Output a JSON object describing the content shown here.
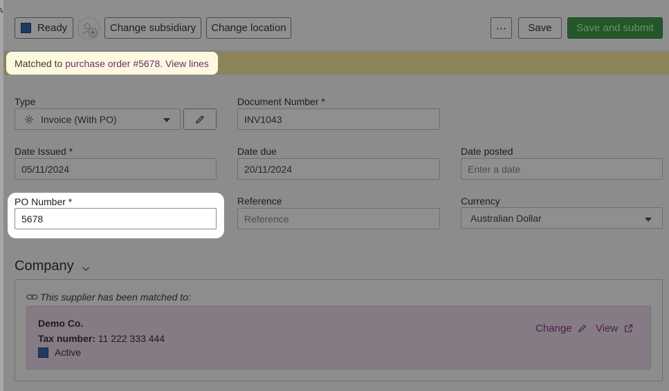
{
  "toolbar": {
    "status_label": "Ready",
    "change_subsidiary": "Change subsidiary",
    "change_location": "Change location",
    "more_label": "⋯",
    "save_label": "Save",
    "submit_label": "Save and submit"
  },
  "banner": {
    "prefix": "Matched to",
    "link": "purchase order #5678. View lines"
  },
  "form": {
    "type_label": "Type",
    "type_value": "Invoice (With PO)",
    "doc_label": "Document Number *",
    "doc_value": "INV1043",
    "date_issued_label": "Date Issued *",
    "date_issued_value": "05/11/2024",
    "date_due_label": "Date due",
    "date_due_value": "20/11/2024",
    "date_posted_label": "Date posted",
    "date_posted_placeholder": "Enter a date",
    "po_label": "PO Number *",
    "po_value": "5678",
    "reference_label": "Reference",
    "reference_placeholder": "Reference",
    "currency_label": "Currency",
    "currency_value": "Australian Dollar"
  },
  "company": {
    "title": "Company",
    "matched_text": "This supplier has been matched to:",
    "name": "Demo Co.",
    "tax_label": "Tax number:",
    "tax_value": "11 222 333 444",
    "status": "Active",
    "change_label": "Change",
    "view_label": "View"
  },
  "colors": {
    "status_square": "#1e3c62",
    "submit_green": "#25562a",
    "link_purple": "#6d2d6d",
    "banner_bg": "#fdf8e0"
  }
}
